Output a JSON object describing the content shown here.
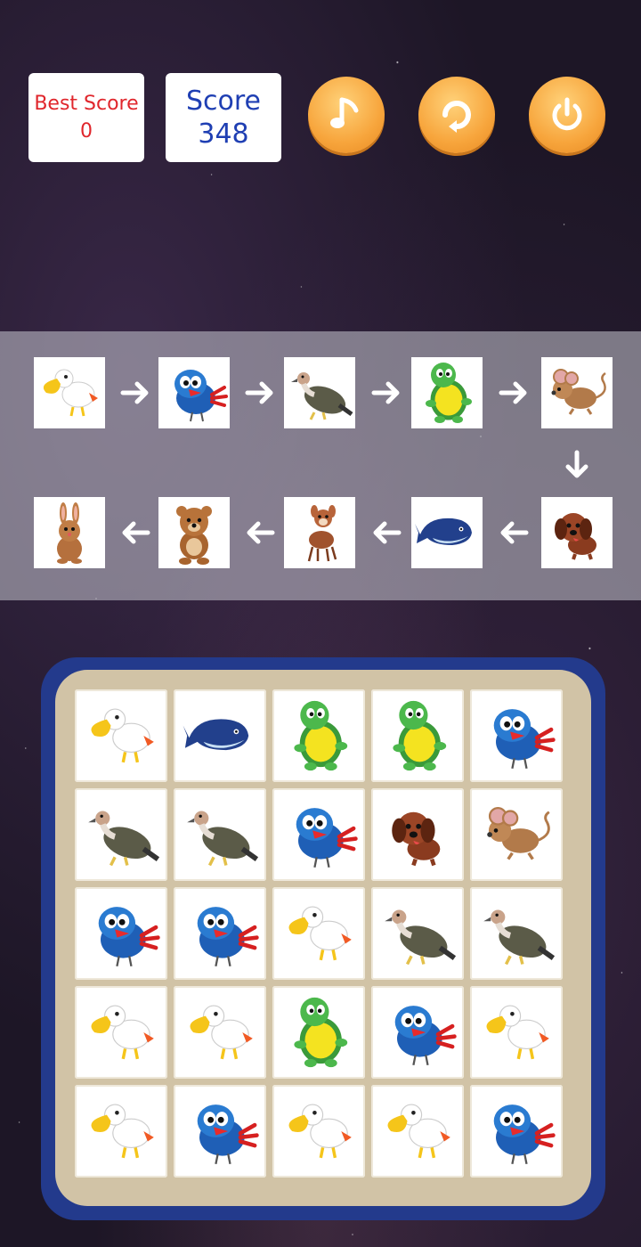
{
  "hud": {
    "best_score_label": "Best Score",
    "best_score_value": "0",
    "score_label": "Score",
    "score_value": "348"
  },
  "buttons": [
    {
      "name": "music-button",
      "icon": "music-note-icon"
    },
    {
      "name": "restart-button",
      "icon": "restart-icon"
    },
    {
      "name": "power-button",
      "icon": "power-icon"
    }
  ],
  "evolution_chain": [
    "pelican",
    "bluebird",
    "vulture",
    "turtle",
    "mouse",
    "puppy",
    "whale",
    "deer",
    "bear",
    "rabbit"
  ],
  "board": [
    [
      "pelican",
      "whale",
      "turtle",
      "turtle",
      "bluebird"
    ],
    [
      "vulture",
      "vulture",
      "bluebird",
      "puppy",
      "mouse"
    ],
    [
      "bluebird",
      "bluebird",
      "pelican",
      "vulture",
      "vulture"
    ],
    [
      "pelican",
      "pelican",
      "turtle",
      "bluebird",
      "pelican"
    ],
    [
      "pelican",
      "bluebird",
      "pelican",
      "pelican",
      "bluebird"
    ]
  ],
  "colors": {
    "accent": "#f7a53c",
    "board_frame": "#233a8c",
    "board_bg": "#d1c3a6",
    "best_score": "#e0262c",
    "score": "#1f3fb3"
  }
}
